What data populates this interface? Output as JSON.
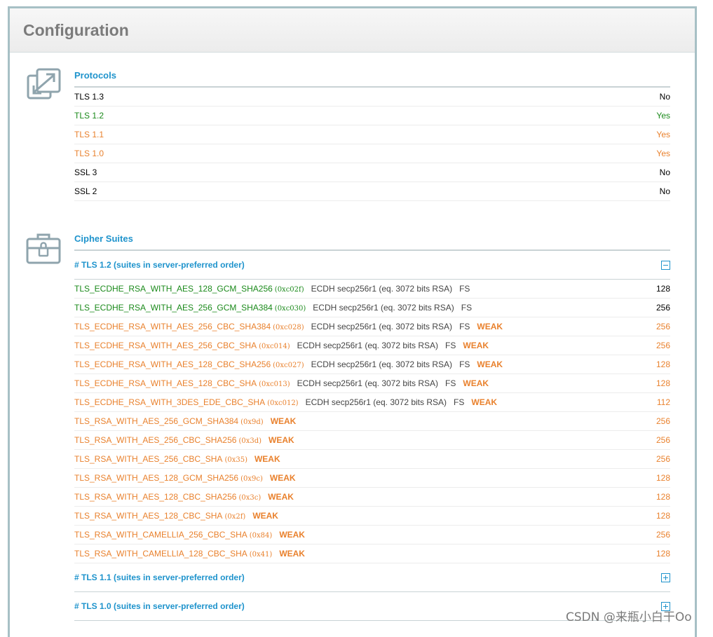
{
  "header": {
    "title": "Configuration"
  },
  "protocols": {
    "title": "Protocols",
    "icon": "resize-arrows-icon",
    "rows": [
      {
        "name": "TLS 1.3",
        "value": "No",
        "color": "black"
      },
      {
        "name": "TLS 1.2",
        "value": "Yes",
        "color": "green"
      },
      {
        "name": "TLS 1.1",
        "value": "Yes",
        "color": "orange"
      },
      {
        "name": "TLS 1.0",
        "value": "Yes",
        "color": "orange"
      },
      {
        "name": "SSL 3",
        "value": "No",
        "color": "black"
      },
      {
        "name": "SSL 2",
        "value": "No",
        "color": "black"
      }
    ]
  },
  "cipher_suites": {
    "title": "Cipher Suites",
    "icon": "toolbox-lock-icon",
    "groups": [
      {
        "title": "# TLS 1.2 (suites in server-preferred order)",
        "expanded": true,
        "rows": [
          {
            "name": "TLS_ECDHE_RSA_WITH_AES_128_GCM_SHA256",
            "code": "(0xc02f)",
            "kex": "ECDH secp256r1 (eq. 3072 bits RSA)",
            "fs": "FS",
            "weak": "",
            "bits": "128",
            "color": "green"
          },
          {
            "name": "TLS_ECDHE_RSA_WITH_AES_256_GCM_SHA384",
            "code": "(0xc030)",
            "kex": "ECDH secp256r1 (eq. 3072 bits RSA)",
            "fs": "FS",
            "weak": "",
            "bits": "256",
            "color": "green"
          },
          {
            "name": "TLS_ECDHE_RSA_WITH_AES_256_CBC_SHA384",
            "code": "(0xc028)",
            "kex": "ECDH secp256r1 (eq. 3072 bits RSA)",
            "fs": "FS",
            "weak": "WEAK",
            "bits": "256",
            "color": "orange"
          },
          {
            "name": "TLS_ECDHE_RSA_WITH_AES_256_CBC_SHA",
            "code": "(0xc014)",
            "kex": "ECDH secp256r1 (eq. 3072 bits RSA)",
            "fs": "FS",
            "weak": "WEAK",
            "bits": "256",
            "color": "orange"
          },
          {
            "name": "TLS_ECDHE_RSA_WITH_AES_128_CBC_SHA256",
            "code": "(0xc027)",
            "kex": "ECDH secp256r1 (eq. 3072 bits RSA)",
            "fs": "FS",
            "weak": "WEAK",
            "bits": "128",
            "color": "orange"
          },
          {
            "name": "TLS_ECDHE_RSA_WITH_AES_128_CBC_SHA",
            "code": "(0xc013)",
            "kex": "ECDH secp256r1 (eq. 3072 bits RSA)",
            "fs": "FS",
            "weak": "WEAK",
            "bits": "128",
            "color": "orange"
          },
          {
            "name": "TLS_ECDHE_RSA_WITH_3DES_EDE_CBC_SHA",
            "code": "(0xc012)",
            "kex": "ECDH secp256r1 (eq. 3072 bits RSA)",
            "fs": "FS",
            "weak": "WEAK",
            "bits": "112",
            "color": "orange"
          },
          {
            "name": "TLS_RSA_WITH_AES_256_GCM_SHA384",
            "code": "(0x9d)",
            "kex": "",
            "fs": "",
            "weak": "WEAK",
            "bits": "256",
            "color": "orange"
          },
          {
            "name": "TLS_RSA_WITH_AES_256_CBC_SHA256",
            "code": "(0x3d)",
            "kex": "",
            "fs": "",
            "weak": "WEAK",
            "bits": "256",
            "color": "orange"
          },
          {
            "name": "TLS_RSA_WITH_AES_256_CBC_SHA",
            "code": "(0x35)",
            "kex": "",
            "fs": "",
            "weak": "WEAK",
            "bits": "256",
            "color": "orange"
          },
          {
            "name": "TLS_RSA_WITH_AES_128_GCM_SHA256",
            "code": "(0x9c)",
            "kex": "",
            "fs": "",
            "weak": "WEAK",
            "bits": "128",
            "color": "orange"
          },
          {
            "name": "TLS_RSA_WITH_AES_128_CBC_SHA256",
            "code": "(0x3c)",
            "kex": "",
            "fs": "",
            "weak": "WEAK",
            "bits": "128",
            "color": "orange"
          },
          {
            "name": "TLS_RSA_WITH_AES_128_CBC_SHA",
            "code": "(0x2f)",
            "kex": "",
            "fs": "",
            "weak": "WEAK",
            "bits": "128",
            "color": "orange"
          },
          {
            "name": "TLS_RSA_WITH_CAMELLIA_256_CBC_SHA",
            "code": "(0x84)",
            "kex": "",
            "fs": "",
            "weak": "WEAK",
            "bits": "256",
            "color": "orange"
          },
          {
            "name": "TLS_RSA_WITH_CAMELLIA_128_CBC_SHA",
            "code": "(0x41)",
            "kex": "",
            "fs": "",
            "weak": "WEAK",
            "bits": "128",
            "color": "orange"
          }
        ]
      },
      {
        "title": "# TLS 1.1 (suites in server-preferred order)",
        "expanded": false,
        "rows": []
      },
      {
        "title": "# TLS 1.0 (suites in server-preferred order)",
        "expanded": false,
        "rows": []
      }
    ]
  },
  "watermark": "CSDN @来瓶小白干Oo",
  "colors": {
    "accent": "#1e93cc",
    "green": "#1b8a1b",
    "orange": "#e9812d",
    "border": "#a7c0c5"
  }
}
